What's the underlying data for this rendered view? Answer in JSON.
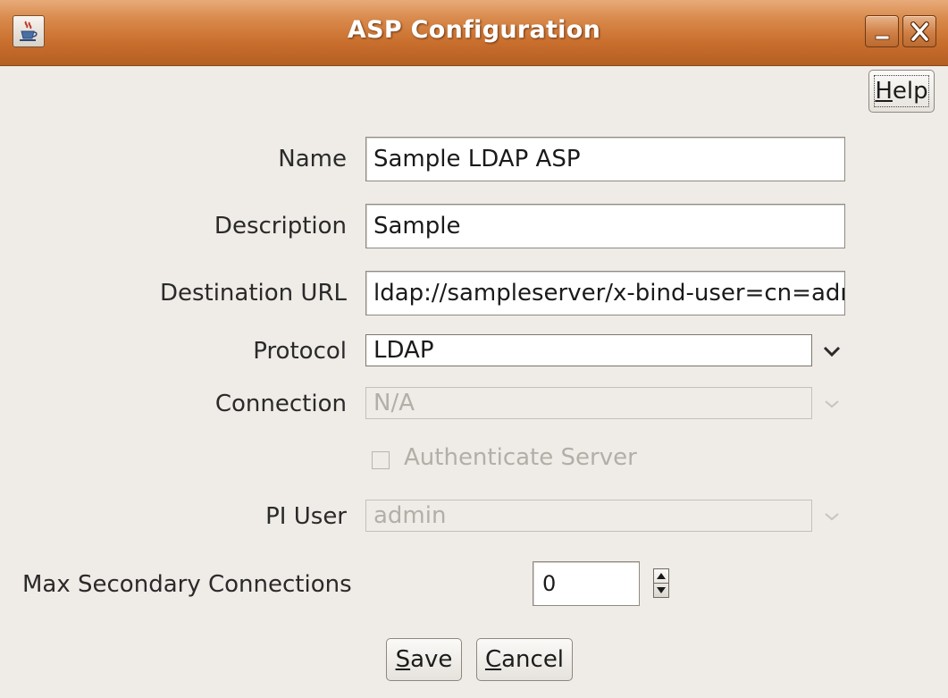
{
  "window": {
    "title": "ASP Configuration",
    "icon": "java-coffee-cup-icon",
    "controls": [
      "minimize-icon",
      "close-icon"
    ]
  },
  "help_button": {
    "mnemonic": "H",
    "rest": "elp"
  },
  "form": {
    "name": {
      "label": "Name",
      "value": "Sample LDAP ASP"
    },
    "description": {
      "label": "Description",
      "value": "Sample"
    },
    "destination_url": {
      "label": "Destination URL",
      "value": "ldap://sampleserver/x-bind-user=cn=adr"
    },
    "protocol": {
      "label": "Protocol",
      "value": "LDAP"
    },
    "connection": {
      "label": "Connection",
      "value": "N/A",
      "enabled": false
    },
    "authenticate_server": {
      "label": "Authenticate Server",
      "checked": false,
      "enabled": false
    },
    "pi_user": {
      "label": "PI User",
      "value": "admin",
      "enabled": false
    },
    "max_secondary_connections": {
      "label": "Max Secondary Connections",
      "value": "0"
    }
  },
  "buttons": {
    "save": {
      "mnemonic": "S",
      "rest": "ave"
    },
    "cancel": {
      "mnemonic": "C",
      "rest": "ancel"
    }
  },
  "colors": {
    "titlebar": "#c96f2e",
    "background": "#efebe7",
    "disabled_text": "#b3aea6"
  }
}
